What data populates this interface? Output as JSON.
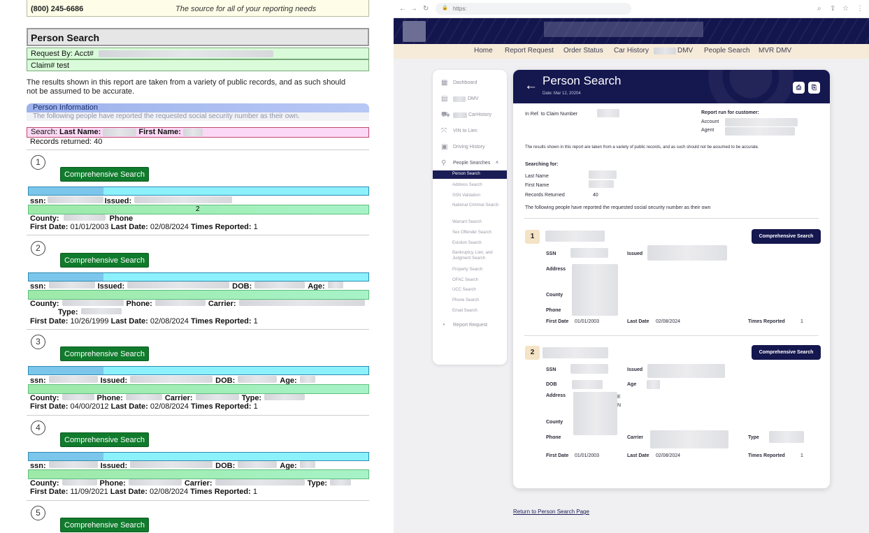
{
  "left_report": {
    "phone": "(800) 245-6686",
    "tagline": "The source for all of your reporting needs",
    "title": "Person Search",
    "request_by_label": "Request By: Acct#",
    "claim_label": "Claim# test",
    "disclaimer_line1": "The results shown in this report are taken from a variety of public records, and as such should",
    "disclaimer_line2": "not be assumed to be accurate.",
    "section_title": "Person Information",
    "section_sub": "The following people have reported the requested social security number as their own.",
    "search_label": "Search:",
    "last_name_label": "Last Name:",
    "first_name_label": "First Name:",
    "records_returned": "Records returned: 40",
    "button_label": "Comprehensive Search",
    "ssn_label": "ssn:",
    "issued_label": "Issued:",
    "dob_label": "DOB:",
    "age_label": "Age:",
    "county_label": "County:",
    "phone_label": "Phone",
    "phone_label_colon": "Phone:",
    "carrier_label": "Carrier:",
    "type_label": "Type:",
    "first_date_label": "First Date:",
    "last_date_label": "Last Date:",
    "times_reported_label": "Times Reported:",
    "records": [
      {
        "num": "1",
        "issued_suffix": "2",
        "first_date": "01/01/2003",
        "last_date": "02/08/2024",
        "times": "1"
      },
      {
        "num": "2",
        "first_date": "10/26/1999",
        "last_date": "02/08/2024",
        "times": "1"
      },
      {
        "num": "3",
        "first_date": "04/00/2012",
        "last_date": "02/08/2024",
        "times": "1"
      },
      {
        "num": "4",
        "first_date": "11/09/2021",
        "last_date": "02/08/2024",
        "times": "1"
      },
      {
        "num": "5"
      }
    ]
  },
  "browser": {
    "url": "https:",
    "nav": [
      "Home",
      "Report Request",
      "Order Status",
      "Car History",
      "DMV",
      "People Search",
      "MVR DMV"
    ],
    "sidebar": {
      "items": [
        {
          "label": "Dashboard",
          "icon": "dashboard-icon"
        },
        {
          "label": "DMV",
          "icon": "document-icon"
        },
        {
          "label": "CarHistory",
          "icon": "car-icon"
        },
        {
          "label": "VIN to Lien",
          "icon": "link-icon"
        },
        {
          "label": "Driving History",
          "icon": "calendar-icon"
        },
        {
          "label": "People Searches",
          "icon": "people-icon"
        }
      ],
      "sub_items": [
        "Person Search",
        "Address Search",
        "SSN Validation",
        "National Criminal Search",
        "Warrant Search",
        "Sex Offender Search",
        "Eviction Search",
        "Bankruptcy, Lien, and Judgment Search",
        "Property Search",
        "OFAC Search",
        "UCC Search",
        "Phone Search",
        "Email Search"
      ],
      "footer": "Report Request"
    },
    "card": {
      "title": "Person Search",
      "date": "Date: Mar 12, 20204",
      "ref_label": "In Ref. to Claim Number",
      "report_run_label": "Report run for customer:",
      "account_label": "Account",
      "agent_label": "Agent",
      "disclaimer": "The results shown in this report are taken from a variety of public records, and as such should not be assumed to be accurate.",
      "searching_for": "Searching for:",
      "last_name": "Last Name",
      "first_name": "First Name",
      "records_returned_label": "Records Returned",
      "records_returned_value": "40",
      "following": "The following people have reported the requested social security number as their own",
      "button_label": "Comprehensive Search",
      "labels": {
        "ssn": "SSN",
        "issued": "Issued",
        "address": "Address",
        "county": "County",
        "phone": "Phone",
        "dob": "DOB",
        "age": "Age",
        "carrier": "Carrier",
        "type": "Type",
        "first_date": "First Date",
        "last_date": "Last Date",
        "times_reported": "Times Reported"
      },
      "records": [
        {
          "num": "1",
          "first_date": "01/01/2003",
          "last_date": "02/08/2024",
          "times": "1"
        },
        {
          "num": "2",
          "address_suffix": "E\nN",
          "first_date": "01/01/2003",
          "last_date": "02/08/2024",
          "times": "1"
        }
      ]
    },
    "return_link": "Return to Person Search Page"
  }
}
